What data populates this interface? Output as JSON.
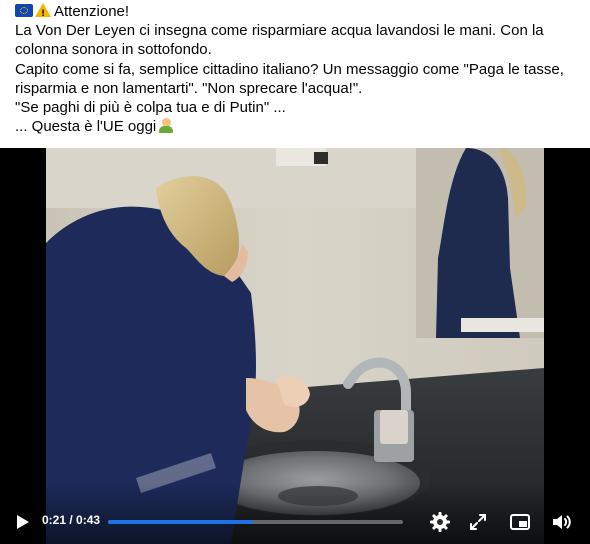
{
  "post": {
    "line1": "Attenzione!",
    "line2": "La Von Der Leyen ci insegna come risparmiare acqua lavandosi le mani. Con la",
    "line3": "colonna sonora in sottofondo.",
    "line4": "Capito come si fa, semplice cittadino italiano? Un messaggio come \"Paga le tasse,",
    "line5": "risparmia e non lamentarti\". \"Non sprecare l'acqua!\".",
    "line6": "\"Se paghi di più è colpa tua e di Putin\" ...",
    "line7": "... Questa è l'UE oggi",
    "emoji_icons": [
      "eu-flag-icon",
      "warning-icon",
      "facepalm-icon"
    ]
  },
  "video": {
    "current_time": "0:21",
    "duration": "0:43",
    "time_label": "0:21 / 0:43",
    "progress_fraction": 0.49,
    "accent_color": "#1b74e4",
    "icons": [
      "play-icon",
      "settings-gear-icon",
      "fullscreen-icon",
      "picture-in-picture-icon",
      "volume-icon"
    ]
  }
}
